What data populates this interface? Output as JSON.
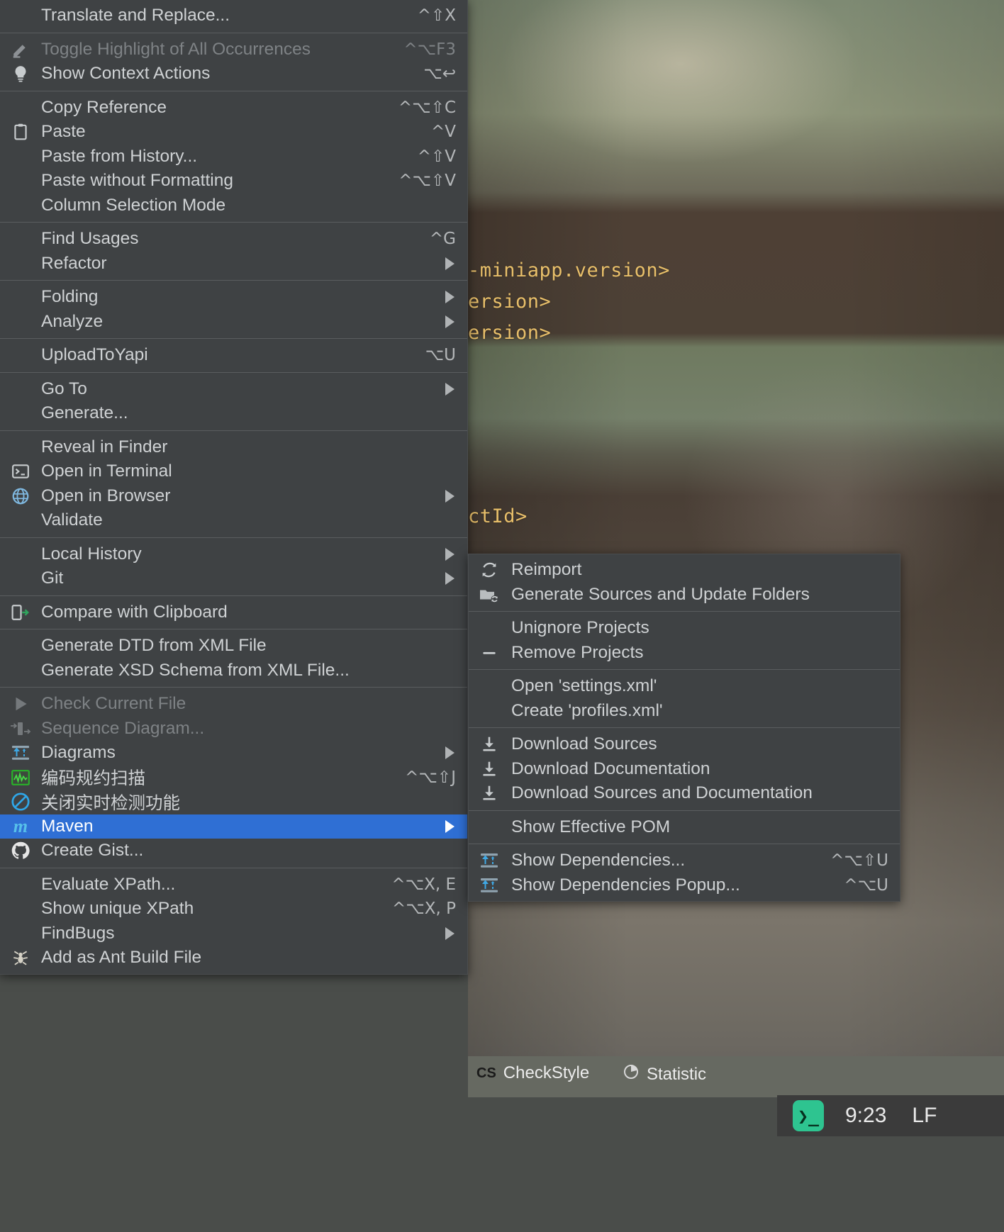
{
  "background": {
    "code_lines": [
      "-miniapp.version>",
      "ersion>",
      "ersion>",
      "ctId>"
    ],
    "status_bar": [
      {
        "label": "CheckStyle",
        "icon": "checkstyle-icon"
      },
      {
        "label": "Statistic",
        "icon": "pie-chart-icon"
      }
    ],
    "taskbar": {
      "terminal_icon": "terminal-icon",
      "clock": "9:23",
      "line_ending": "LF"
    }
  },
  "context_menu": {
    "name": "editor-context-menu",
    "groups": [
      {
        "items": [
          {
            "label": "Translate and Replace...",
            "shortcut": "^⇧X",
            "icon": null,
            "arrow": false,
            "disabled": false,
            "selected": false
          }
        ]
      },
      {
        "items": [
          {
            "label": "Toggle Highlight of All Occurrences",
            "shortcut": "^⌥F3",
            "icon": "pencil-icon",
            "arrow": false,
            "disabled": true,
            "selected": false
          },
          {
            "label": "Show Context Actions",
            "shortcut": "⌥↩",
            "icon": "lightbulb-icon",
            "arrow": false,
            "disabled": false,
            "selected": false
          }
        ]
      },
      {
        "items": [
          {
            "label": "Copy Reference",
            "shortcut": "^⌥⇧C",
            "icon": null,
            "arrow": false,
            "disabled": false,
            "selected": false
          },
          {
            "label": "Paste",
            "shortcut": "^V",
            "icon": "clipboard-icon",
            "arrow": false,
            "disabled": false,
            "selected": false
          },
          {
            "label": "Paste from History...",
            "shortcut": "^⇧V",
            "icon": null,
            "arrow": false,
            "disabled": false,
            "selected": false
          },
          {
            "label": "Paste without Formatting",
            "shortcut": "^⌥⇧V",
            "icon": null,
            "arrow": false,
            "disabled": false,
            "selected": false
          },
          {
            "label": "Column Selection Mode",
            "shortcut": "",
            "icon": null,
            "arrow": false,
            "disabled": false,
            "selected": false
          }
        ]
      },
      {
        "items": [
          {
            "label": "Find Usages",
            "shortcut": "^G",
            "icon": null,
            "arrow": false,
            "disabled": false,
            "selected": false
          },
          {
            "label": "Refactor",
            "shortcut": "",
            "icon": null,
            "arrow": true,
            "disabled": false,
            "selected": false
          }
        ]
      },
      {
        "items": [
          {
            "label": "Folding",
            "shortcut": "",
            "icon": null,
            "arrow": true,
            "disabled": false,
            "selected": false
          },
          {
            "label": "Analyze",
            "shortcut": "",
            "icon": null,
            "arrow": true,
            "disabled": false,
            "selected": false
          }
        ]
      },
      {
        "items": [
          {
            "label": "UploadToYapi",
            "shortcut": "⌥U",
            "icon": null,
            "arrow": false,
            "disabled": false,
            "selected": false
          }
        ]
      },
      {
        "items": [
          {
            "label": "Go To",
            "shortcut": "",
            "icon": null,
            "arrow": true,
            "disabled": false,
            "selected": false
          },
          {
            "label": "Generate...",
            "shortcut": "",
            "icon": null,
            "arrow": false,
            "disabled": false,
            "selected": false
          }
        ]
      },
      {
        "items": [
          {
            "label": "Reveal in Finder",
            "shortcut": "",
            "icon": null,
            "arrow": false,
            "disabled": false,
            "selected": false
          },
          {
            "label": "Open in Terminal",
            "shortcut": "",
            "icon": "terminal-icon",
            "arrow": false,
            "disabled": false,
            "selected": false
          },
          {
            "label": "Open in Browser",
            "shortcut": "",
            "icon": "globe-icon",
            "arrow": true,
            "disabled": false,
            "selected": false
          },
          {
            "label": "Validate",
            "shortcut": "",
            "icon": null,
            "arrow": false,
            "disabled": false,
            "selected": false
          }
        ]
      },
      {
        "items": [
          {
            "label": "Local History",
            "shortcut": "",
            "icon": null,
            "arrow": true,
            "disabled": false,
            "selected": false
          },
          {
            "label": "Git",
            "shortcut": "",
            "icon": null,
            "arrow": true,
            "disabled": false,
            "selected": false
          }
        ]
      },
      {
        "items": [
          {
            "label": "Compare with Clipboard",
            "shortcut": "",
            "icon": "compare-icon",
            "arrow": false,
            "disabled": false,
            "selected": false
          }
        ]
      },
      {
        "items": [
          {
            "label": "Generate DTD from XML File",
            "shortcut": "",
            "icon": null,
            "arrow": false,
            "disabled": false,
            "selected": false
          },
          {
            "label": "Generate XSD Schema from XML File...",
            "shortcut": "",
            "icon": null,
            "arrow": false,
            "disabled": false,
            "selected": false
          }
        ]
      },
      {
        "items": [
          {
            "label": "Check Current File",
            "shortcut": "",
            "icon": "play-icon",
            "arrow": false,
            "disabled": true,
            "selected": false
          },
          {
            "label": "Sequence Diagram...",
            "shortcut": "",
            "icon": "sequence-diagram-icon",
            "arrow": false,
            "disabled": true,
            "selected": false
          },
          {
            "label": "Diagrams",
            "shortcut": "",
            "icon": "diagram-icon",
            "arrow": true,
            "disabled": false,
            "selected": false
          },
          {
            "label": "编码规约扫描",
            "shortcut": "^⌥⇧J",
            "icon": "wave-scan-icon",
            "arrow": false,
            "disabled": false,
            "selected": false
          },
          {
            "label": "关闭实时检测功能",
            "shortcut": "",
            "icon": "no-entry-icon",
            "arrow": false,
            "disabled": false,
            "selected": false
          },
          {
            "label": "Maven",
            "shortcut": "",
            "icon": "maven-icon",
            "arrow": true,
            "disabled": false,
            "selected": true
          },
          {
            "label": "Create Gist...",
            "shortcut": "",
            "icon": "github-icon",
            "arrow": false,
            "disabled": false,
            "selected": false
          }
        ]
      },
      {
        "items": [
          {
            "label": "Evaluate XPath...",
            "shortcut": "^⌥X, E",
            "icon": null,
            "arrow": false,
            "disabled": false,
            "selected": false
          },
          {
            "label": "Show unique XPath",
            "shortcut": "^⌥X, P",
            "icon": null,
            "arrow": false,
            "disabled": false,
            "selected": false
          },
          {
            "label": "FindBugs",
            "shortcut": "",
            "icon": null,
            "arrow": true,
            "disabled": false,
            "selected": false
          },
          {
            "label": "Add as Ant Build File",
            "shortcut": "",
            "icon": "ant-icon",
            "arrow": false,
            "disabled": false,
            "selected": false
          }
        ]
      }
    ]
  },
  "maven_submenu": {
    "name": "maven-submenu",
    "groups": [
      {
        "items": [
          {
            "label": "Reimport",
            "shortcut": "",
            "icon": "refresh-icon",
            "arrow": false,
            "disabled": false,
            "selected": false
          },
          {
            "label": "Generate Sources and Update Folders",
            "shortcut": "",
            "icon": "folder-refresh-icon",
            "arrow": false,
            "disabled": false,
            "selected": false
          }
        ]
      },
      {
        "items": [
          {
            "label": "Unignore Projects",
            "shortcut": "",
            "icon": null,
            "arrow": false,
            "disabled": false,
            "selected": false
          },
          {
            "label": "Remove Projects",
            "shortcut": "",
            "icon": "minus-icon",
            "arrow": false,
            "disabled": false,
            "selected": false
          }
        ]
      },
      {
        "items": [
          {
            "label": "Open 'settings.xml'",
            "shortcut": "",
            "icon": null,
            "arrow": false,
            "disabled": false,
            "selected": false
          },
          {
            "label": "Create 'profiles.xml'",
            "shortcut": "",
            "icon": null,
            "arrow": false,
            "disabled": false,
            "selected": false
          }
        ]
      },
      {
        "items": [
          {
            "label": "Download Sources",
            "shortcut": "",
            "icon": "download-icon",
            "arrow": false,
            "disabled": false,
            "selected": false
          },
          {
            "label": "Download Documentation",
            "shortcut": "",
            "icon": "download-icon",
            "arrow": false,
            "disabled": false,
            "selected": false
          },
          {
            "label": "Download Sources and Documentation",
            "shortcut": "",
            "icon": "download-icon",
            "arrow": false,
            "disabled": false,
            "selected": false
          }
        ]
      },
      {
        "items": [
          {
            "label": "Show Effective POM",
            "shortcut": "",
            "icon": null,
            "arrow": false,
            "disabled": false,
            "selected": false
          }
        ]
      },
      {
        "items": [
          {
            "label": "Show Dependencies...",
            "shortcut": "^⌥⇧U",
            "icon": "diagram-icon",
            "arrow": false,
            "disabled": false,
            "selected": false
          },
          {
            "label": "Show Dependencies Popup...",
            "shortcut": "^⌥U",
            "icon": "diagram-icon",
            "arrow": false,
            "disabled": false,
            "selected": false
          }
        ]
      }
    ]
  },
  "colors": {
    "menu_bg": "#3f4244",
    "selection": "#2f6fd4",
    "text": "#cfd2d4",
    "disabled_text": "#7e8285",
    "separator": "#5a5d5f",
    "code_tag": "#e8bf6a",
    "accent_blue": "#56c0ea",
    "accent_green": "#2ec490"
  }
}
